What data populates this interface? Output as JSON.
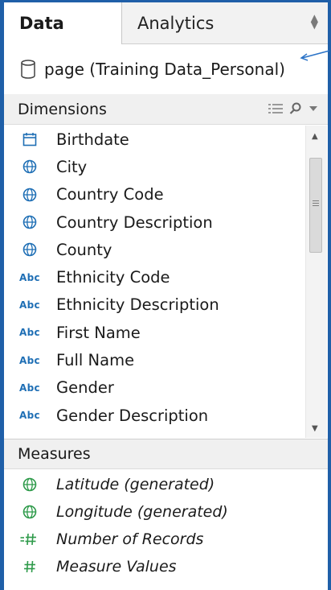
{
  "tabs": {
    "data": "Data",
    "analytics": "Analytics"
  },
  "source": {
    "name": "page (Training Data_Personal)",
    "icon": "database-cylinder-icon"
  },
  "dimensions": {
    "header": "Dimensions",
    "items": [
      {
        "label": "Birthdate",
        "icon": "calendar-icon"
      },
      {
        "label": "City",
        "icon": "globe-icon"
      },
      {
        "label": "Country Code",
        "icon": "globe-icon"
      },
      {
        "label": "Country Description",
        "icon": "globe-icon"
      },
      {
        "label": "County",
        "icon": "globe-icon"
      },
      {
        "label": "Ethnicity Code",
        "icon": "abc-icon"
      },
      {
        "label": "Ethnicity Description",
        "icon": "abc-icon"
      },
      {
        "label": "First Name",
        "icon": "abc-icon"
      },
      {
        "label": "Full Name",
        "icon": "abc-icon"
      },
      {
        "label": "Gender",
        "icon": "abc-icon"
      },
      {
        "label": "Gender Description",
        "icon": "abc-icon"
      }
    ]
  },
  "measures": {
    "header": "Measures",
    "items": [
      {
        "label": "Latitude (generated)",
        "icon": "globe-icon"
      },
      {
        "label": "Longitude (generated)",
        "icon": "globe-icon"
      },
      {
        "label": "Number of Records",
        "icon": "hash-equals-icon"
      },
      {
        "label": "Measure Values",
        "icon": "hash-icon"
      }
    ]
  },
  "abc_text": "Abc",
  "colors": {
    "accent": "#1f5fa8",
    "dimension_icon": "#1f6fb5",
    "measure_icon": "#2e9a4a"
  }
}
